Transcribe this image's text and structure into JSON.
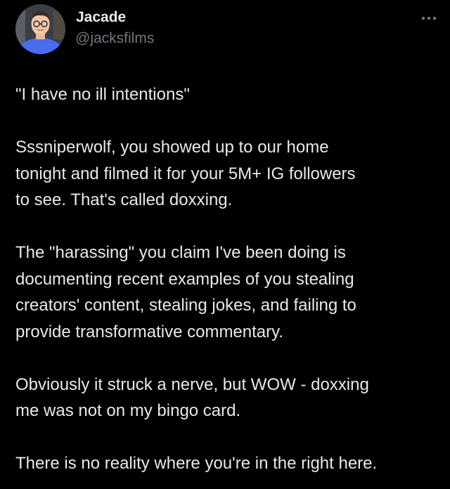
{
  "tweet": {
    "display_name": "Jacade",
    "handle": "@jacksfilms",
    "avatar_icon": "user-avatar-icon",
    "more_icon": "more-horizontal-icon",
    "paragraphs": [
      "\"I have no ill intentions\"",
      "Sssniperwolf, you showed up to our home\ntonight and filmed it for your 5M+ IG followers\nto see. That's called doxxing.",
      "The \"harassing\" you claim I've been doing is\ndocumenting recent examples of you stealing\ncreators' content, stealing jokes, and failing to\nprovide transformative commentary.",
      "Obviously it struck a nerve, but WOW - doxxing\nme was not on my bingo card.",
      "There is no reality where you're in the right here."
    ]
  },
  "colors": {
    "background": "#000000",
    "text_primary": "#e7e9ea",
    "text_secondary": "#71767b",
    "avatar_bg": "#4a6cf0"
  }
}
